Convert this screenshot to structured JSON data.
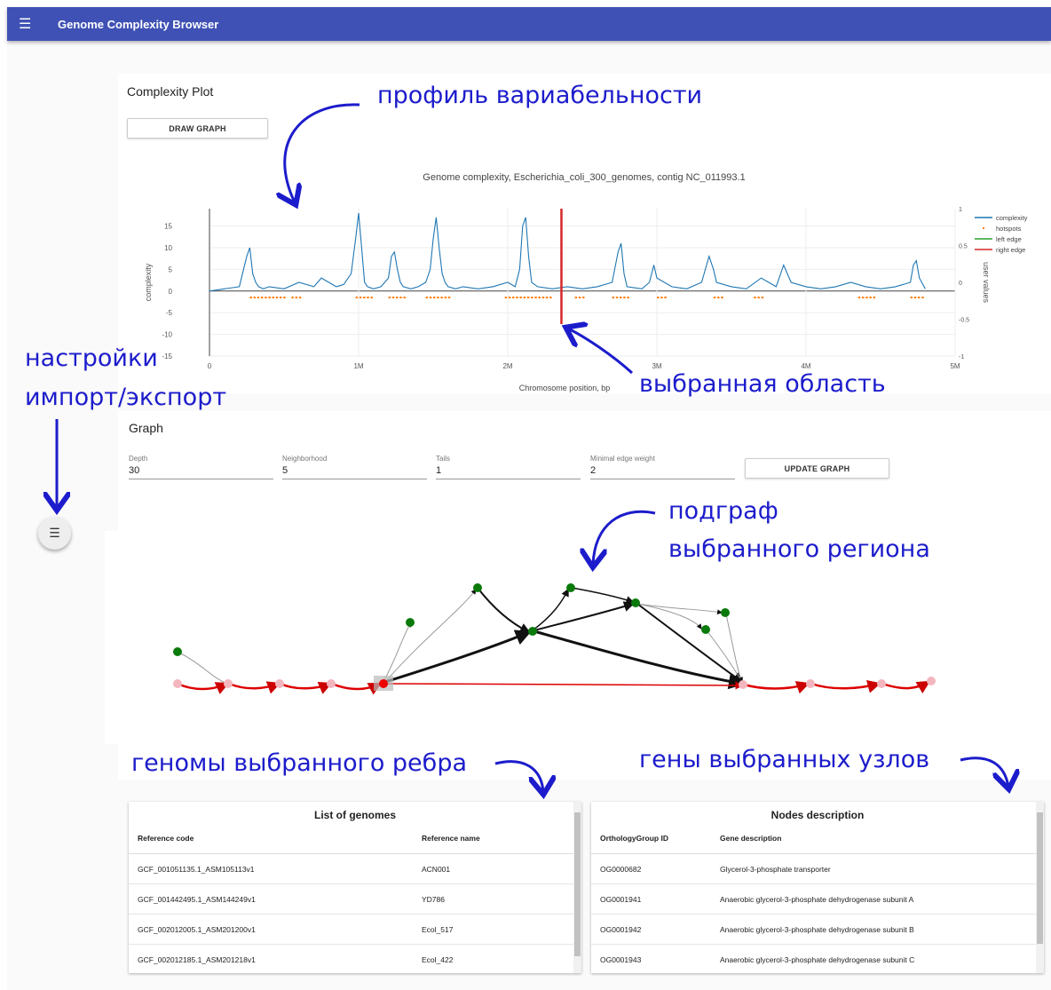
{
  "app": {
    "title": "Genome Complexity Browser",
    "menu_icon": "hamburger-icon"
  },
  "complexity": {
    "title": "Complexity Plot",
    "draw_button": "DRAW GRAPH"
  },
  "chart_data": {
    "type": "line",
    "title": "Genome complexity, Escherichia_coli_300_genomes, contig NC_011993.1",
    "xlabel": "Chromosome position, bp",
    "ylabel": "complexity",
    "y2label": "user values",
    "xlim": [
      0,
      5000000
    ],
    "ylim": [
      -15,
      19
    ],
    "y2lim": [
      -1,
      1
    ],
    "x_ticks": [
      "0",
      "1M",
      "2M",
      "3M",
      "4M",
      "5M"
    ],
    "y_ticks": [
      "15",
      "10",
      "5",
      "0",
      "-5",
      "-10",
      "-15"
    ],
    "y2_ticks": [
      "1",
      "0.5",
      "0",
      "-0.5",
      "-1"
    ],
    "legend_position": "top-right",
    "series": [
      {
        "name": "complexity",
        "color": "#1f77b4",
        "x": [
          0,
          100000,
          200000,
          250000,
          270000,
          290000,
          310000,
          330000,
          360000,
          400000,
          500000,
          600000,
          700000,
          750000,
          800000,
          850000,
          900000,
          950000,
          980000,
          1000000,
          1020000,
          1040000,
          1060000,
          1100000,
          1150000,
          1200000,
          1220000,
          1240000,
          1260000,
          1280000,
          1300000,
          1350000,
          1400000,
          1450000,
          1480000,
          1500000,
          1520000,
          1540000,
          1560000,
          1580000,
          1600000,
          1650000,
          1700000,
          1800000,
          1900000,
          2000000,
          2050000,
          2080000,
          2100000,
          2120000,
          2140000,
          2160000,
          2200000,
          2300000,
          2400000,
          2500000,
          2600000,
          2700000,
          2740000,
          2760000,
          2780000,
          2800000,
          2900000,
          2950000,
          2980000,
          3000000,
          3100000,
          3200000,
          3300000,
          3350000,
          3380000,
          3400000,
          3500000,
          3600000,
          3700000,
          3800000,
          3850000,
          3900000,
          4000000,
          4100000,
          4200000,
          4300000,
          4400000,
          4500000,
          4600000,
          4700000,
          4720000,
          4740000,
          4760000,
          4800000
        ],
        "y": [
          0,
          0.5,
          1,
          8,
          10,
          4,
          2,
          1,
          0.5,
          1,
          0.5,
          2,
          1,
          3,
          2,
          1,
          1.5,
          4,
          12,
          18,
          10,
          2,
          1,
          0.5,
          1,
          3,
          8,
          9,
          5,
          2,
          1,
          0.5,
          1,
          2,
          5,
          12,
          17,
          10,
          4,
          2,
          1,
          0.5,
          1,
          0.5,
          1,
          2,
          1,
          5,
          15,
          17,
          8,
          2,
          1,
          0.5,
          1,
          0.5,
          1,
          2,
          9,
          11,
          4,
          1,
          0.5,
          2,
          6,
          3,
          1,
          0.5,
          2,
          8,
          5,
          2,
          1,
          0.5,
          3,
          1,
          6,
          2,
          1,
          0.5,
          1,
          2,
          1,
          0.5,
          1,
          2,
          6,
          7,
          3,
          0.5
        ]
      },
      {
        "name": "hotspots",
        "color": "#ff7f0e",
        "ranges": [
          [
            270000,
            500000
          ],
          [
            550000,
            620000
          ],
          [
            980000,
            1100000
          ],
          [
            1200000,
            1300000
          ],
          [
            1450000,
            1600000
          ],
          [
            1980000,
            2300000
          ],
          [
            2450000,
            2500000
          ],
          [
            2700000,
            2800000
          ],
          [
            3000000,
            3050000
          ],
          [
            3380000,
            3450000
          ],
          [
            3650000,
            3700000
          ],
          [
            4350000,
            4450000
          ],
          [
            4700000,
            4780000
          ]
        ],
        "y": -1.5
      },
      {
        "name": "left edge",
        "color": "#2ca02c"
      },
      {
        "name": "right edge",
        "color": "#d62728",
        "x": 2360000
      }
    ]
  },
  "annotations": {
    "variability_profile": "профиль вариабельности",
    "selected_area": "выбранная область",
    "settings": "настройки",
    "import_export": "импорт/экспорт",
    "subgraph_line1": "подграф",
    "subgraph_line2": "выбранного региона",
    "edge_genomes": "геномы выбранного ребра",
    "node_genes": "гены выбранных узлов"
  },
  "graph": {
    "title": "Graph",
    "fields": [
      {
        "label": "Depth",
        "value": "30"
      },
      {
        "label": "Neighborhood",
        "value": "5"
      },
      {
        "label": "Tails",
        "value": "1"
      },
      {
        "label": "Minimal edge weight",
        "value": "2"
      }
    ],
    "update_button": "UPDATE GRAPH"
  },
  "genomes": {
    "title": "List of genomes",
    "columns": [
      "Reference code",
      "Reference name"
    ],
    "rows": [
      [
        "GCF_001051135.1_ASM105113v1",
        "ACN001"
      ],
      [
        "GCF_001442495.1_ASM144249v1",
        "YD786"
      ],
      [
        "GCF_002012005.1_ASM201200v1",
        "Ecol_517"
      ],
      [
        "GCF_002012185.1_ASM201218v1",
        "Ecol_422"
      ]
    ]
  },
  "nodes": {
    "title": "Nodes description",
    "columns": [
      "OrthologyGroup ID",
      "Gene description"
    ],
    "rows": [
      [
        "OG0000682",
        "Glycerol-3-phosphate transporter"
      ],
      [
        "OG0001941",
        "Anaerobic glycerol-3-phosphate dehydrogenase subunit A"
      ],
      [
        "OG0001942",
        "Anaerobic glycerol-3-phosphate dehydrogenase subunit B"
      ],
      [
        "OG0001943",
        "Anaerobic glycerol-3-phosphate dehydrogenase subunit C"
      ]
    ]
  }
}
